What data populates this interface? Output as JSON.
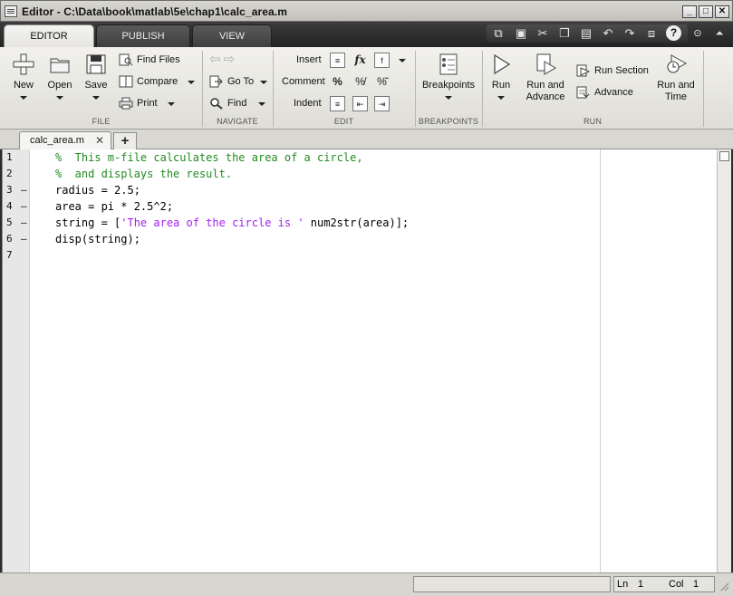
{
  "window": {
    "title": "Editor - C:\\Data\\book\\matlab\\5e\\chap1\\calc_area.m",
    "minimize": "_",
    "maximize": "□",
    "close": "✕"
  },
  "ribbon_tabs": [
    "EDITOR",
    "PUBLISH",
    "VIEW"
  ],
  "ribbon": {
    "file": {
      "label": "FILE",
      "new": "New",
      "open": "Open",
      "save": "Save",
      "find_files": "Find Files",
      "compare": "Compare",
      "print": "Print"
    },
    "navigate": {
      "label": "NAVIGATE",
      "go_to": "Go To",
      "find": "Find"
    },
    "edit": {
      "label": "EDIT",
      "insert": "Insert",
      "comment": "Comment",
      "indent": "Indent",
      "fx": "fx",
      "percent": "%"
    },
    "breakpoints": {
      "label": "BREAKPOINTS",
      "breakpoints": "Breakpoints"
    },
    "run": {
      "label": "RUN",
      "run": "Run",
      "run_and_advance_1": "Run and",
      "run_and_advance_2": "Advance",
      "run_section": "Run Section",
      "advance": "Advance",
      "run_and_time_1": "Run and",
      "run_and_time_2": "Time"
    }
  },
  "doc_tab": {
    "name": "calc_area.m",
    "close": "✕",
    "add": "+"
  },
  "editor": {
    "lines": [
      {
        "num": "1",
        "marker": "",
        "text": "%  This m-file calculates the area of a circle,",
        "comment": true
      },
      {
        "num": "2",
        "marker": "",
        "text": "%  and displays the result.",
        "comment": true
      },
      {
        "num": "3",
        "marker": "–",
        "text": "radius = 2.5;",
        "comment": false
      },
      {
        "num": "4",
        "marker": "–",
        "text": "area = pi * 2.5^2;",
        "comment": false
      },
      {
        "num": "5",
        "marker": "–",
        "text_before": "string = [",
        "string_literal": "'The area of the circle is '",
        "text_after": " num2str(area)];",
        "comment": false
      },
      {
        "num": "6",
        "marker": "–",
        "text": "disp(string);",
        "comment": false
      },
      {
        "num": "7",
        "marker": "",
        "text": "",
        "comment": false
      }
    ]
  },
  "status": {
    "ln_label": "Ln",
    "ln_value": "1",
    "col_label": "Col",
    "col_value": "1"
  },
  "colors": {
    "comment": "#228b22",
    "string": "#a020f0",
    "ribbon_dark": "#2b2b2b"
  }
}
